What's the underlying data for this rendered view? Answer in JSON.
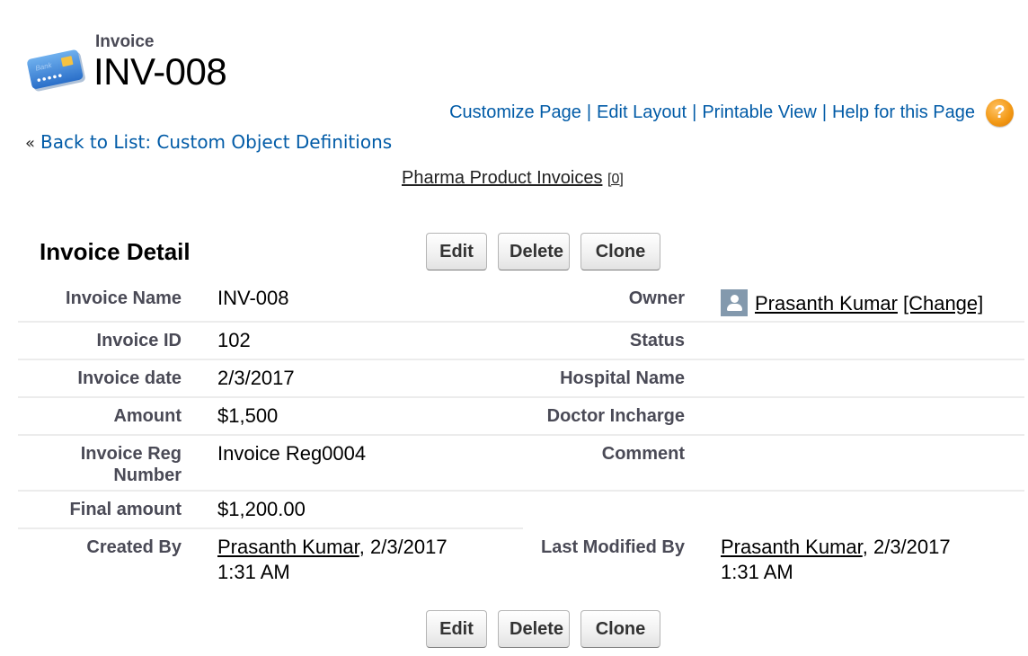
{
  "header": {
    "object_type": "Invoice",
    "record_title": "INV-008",
    "icon": "credit-card-icon"
  },
  "top_links": {
    "customize_page": "Customize Page",
    "edit_layout": "Edit Layout",
    "printable_view": "Printable View",
    "help": "Help for this Page",
    "separator": "|",
    "help_icon": "?"
  },
  "back_link": {
    "prefix": "«",
    "label": "Back to List: Custom Object Definitions"
  },
  "related_list_link": {
    "label": "Pharma Product Invoices",
    "count": "[0]"
  },
  "detail": {
    "title": "Invoice Detail",
    "buttons": {
      "edit": "Edit",
      "delete": "Delete",
      "clone": "Clone"
    },
    "fields_left": [
      {
        "label": "Invoice Name",
        "value": "INV-008"
      },
      {
        "label": "Invoice ID",
        "value": "102"
      },
      {
        "label": "Invoice date",
        "value": "2/3/2017"
      },
      {
        "label": "Amount",
        "value": "$1,500"
      },
      {
        "label": "Invoice Reg Number",
        "value": "Invoice Reg0004"
      },
      {
        "label": "Final amount",
        "value": "$1,200.00"
      }
    ],
    "fields_right": [
      {
        "label": "Owner",
        "value": "Prasanth Kumar",
        "action": "[Change]"
      },
      {
        "label": "Status",
        "value": ""
      },
      {
        "label": "Hospital Name",
        "value": ""
      },
      {
        "label": "Doctor Incharge",
        "value": ""
      },
      {
        "label": "Comment",
        "value": ""
      }
    ],
    "created_by": {
      "label": "Created By",
      "user": "Prasanth Kumar",
      "timestamp": ", 2/3/2017 1:31 AM"
    },
    "last_modified_by": {
      "label": "Last Modified By",
      "user": "Prasanth Kumar",
      "timestamp": ", 2/3/2017 1:31 AM"
    }
  },
  "colors": {
    "link_blue": "#015ba7",
    "label_gray": "#4a4a56",
    "row_border": "#ececec",
    "help_orange": "#f39a17",
    "avatar_bg": "#8399ad"
  }
}
